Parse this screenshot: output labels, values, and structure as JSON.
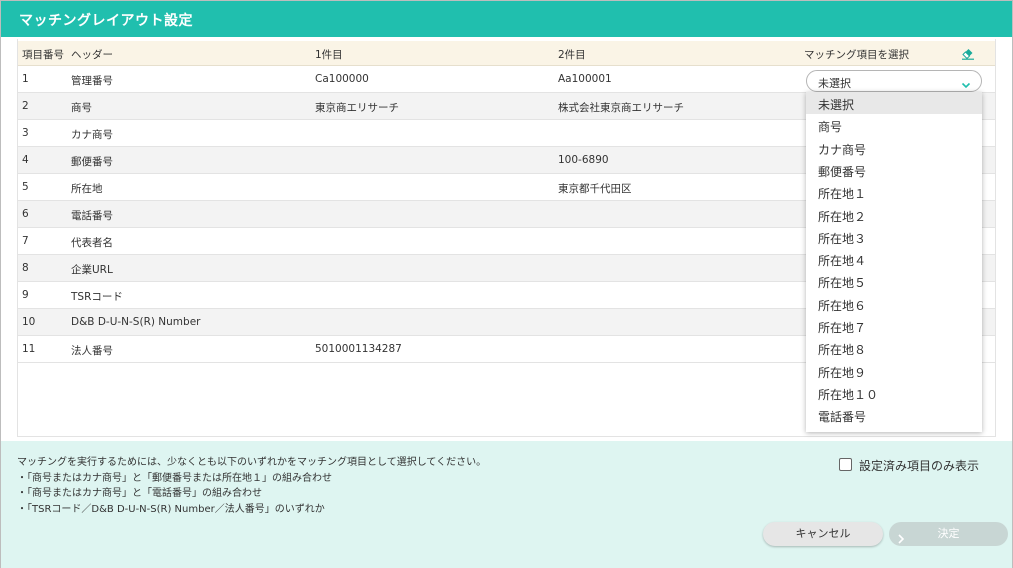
{
  "window": {
    "title": "マッチングレイアウト設定"
  },
  "table": {
    "headers": {
      "index": "項目番号",
      "header": "ヘッダー",
      "first": "1件目",
      "second": "2件目",
      "select": "マッチング項目を選択"
    },
    "rows": [
      {
        "no": "1",
        "header": "管理番号",
        "first": "Ca100000",
        "second": "Aa100001"
      },
      {
        "no": "2",
        "header": "商号",
        "first": "東京商エリサーチ",
        "second": "株式会社東京商エリサーチ"
      },
      {
        "no": "3",
        "header": "カナ商号",
        "first": "",
        "second": ""
      },
      {
        "no": "4",
        "header": "郵便番号",
        "first": "",
        "second": "100-6890"
      },
      {
        "no": "5",
        "header": "所在地",
        "first": "",
        "second": "東京都千代田区"
      },
      {
        "no": "6",
        "header": "電話番号",
        "first": "",
        "second": ""
      },
      {
        "no": "7",
        "header": "代表者名",
        "first": "",
        "second": ""
      },
      {
        "no": "8",
        "header": "企業URL",
        "first": "",
        "second": ""
      },
      {
        "no": "9",
        "header": "TSRコード",
        "first": "",
        "second": ""
      },
      {
        "no": "10",
        "header": "D&B D-U-N-S(R) Number",
        "first": "",
        "second": ""
      },
      {
        "no": "11",
        "header": "法人番号",
        "first": "5010001134287",
        "second": ""
      }
    ],
    "row1_select_value": "未選択"
  },
  "dropdown": {
    "options": [
      "未選択",
      "商号",
      "カナ商号",
      "郵便番号",
      "所在地１",
      "所在地２",
      "所在地３",
      "所在地４",
      "所在地５",
      "所在地６",
      "所在地７",
      "所在地８",
      "所在地９",
      "所在地１０",
      "電話番号"
    ],
    "selected": "未選択"
  },
  "notes": {
    "lines": [
      "マッチングを実行するためには、少なくとも以下のいずれかをマッチング項目として選択してください。",
      "・「商号またはカナ商号」と「郵便番号または所在地１」の組み合わせ",
      "・「商号またはカナ商号」と「電話番号」の組み合わせ",
      "・「TSRコード／D&B D-U-N-S(R) Number／法人番号」のいずれか"
    ]
  },
  "filter": {
    "label": "設定済み項目のみ表示",
    "checked": false
  },
  "buttons": {
    "cancel": "キャンセル",
    "ok": "決定"
  },
  "colors": {
    "accent": "#20bfae",
    "header_bg": "#faf4e6",
    "bottom_bg": "#def5f1",
    "eraser": "#1aab9b"
  },
  "icons": {
    "eraser": "eraser-icon",
    "chevron": "chevron-down-icon",
    "arrow": "chevron-right-icon",
    "checkbox": "checkbox-icon"
  }
}
